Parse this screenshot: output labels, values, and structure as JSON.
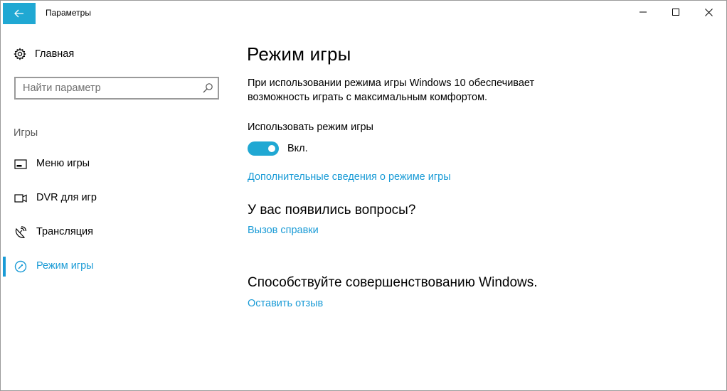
{
  "window": {
    "title": "Параметры",
    "accent": "#20a8d3"
  },
  "sidebar": {
    "home_label": "Главная",
    "search_placeholder": "Найти параметр",
    "section": "Игры",
    "items": [
      {
        "label": "Меню игры",
        "icon": "game-bar-icon",
        "active": false
      },
      {
        "label": "DVR для игр",
        "icon": "dvr-icon",
        "active": false
      },
      {
        "label": "Трансляция",
        "icon": "broadcast-icon",
        "active": false
      },
      {
        "label": "Режим игры",
        "icon": "game-mode-icon",
        "active": true
      }
    ]
  },
  "main": {
    "title": "Режим игры",
    "description": "При использовании режима игры Windows 10 обеспечивает возможность играть с максимальным комфортом.",
    "toggle_label": "Использовать режим игры",
    "toggle_state": "Вкл.",
    "toggle_on": true,
    "more_info_link": "Дополнительные сведения о режиме игры",
    "questions_heading": "У вас появились вопросы?",
    "help_link": "Вызов справки",
    "improve_heading": "Способствуйте совершенствованию Windows.",
    "feedback_link": "Оставить отзыв"
  }
}
